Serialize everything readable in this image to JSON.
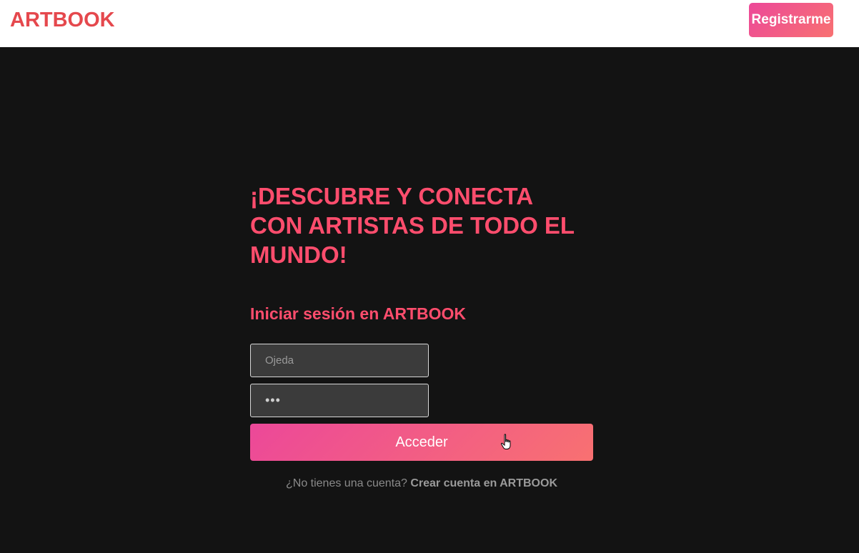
{
  "header": {
    "logo": "ARTBOOK",
    "register_label": "Registrarme"
  },
  "hero": {
    "headline": "¡DESCUBRE Y CONECTA CON ARTISTAS DE TODO EL MUNDO!"
  },
  "login": {
    "title": "Iniciar sesión en ARTBOOK",
    "username_placeholder": "Ojeda",
    "username_value": "",
    "password_value": "•••",
    "submit_label": "Acceder",
    "no_account_text": "¿No tienes una cuenta?",
    "create_account_link": "Crear cuenta en ARTBOOK"
  },
  "colors": {
    "accent": "#ff4d6d",
    "logo": "#e5484d",
    "gradient_start": "#ec4899",
    "gradient_end": "#f87171",
    "background": "#131313",
    "input_bg": "#3b3b3b"
  },
  "icons": {
    "cursor": "hand-pointer-icon"
  }
}
